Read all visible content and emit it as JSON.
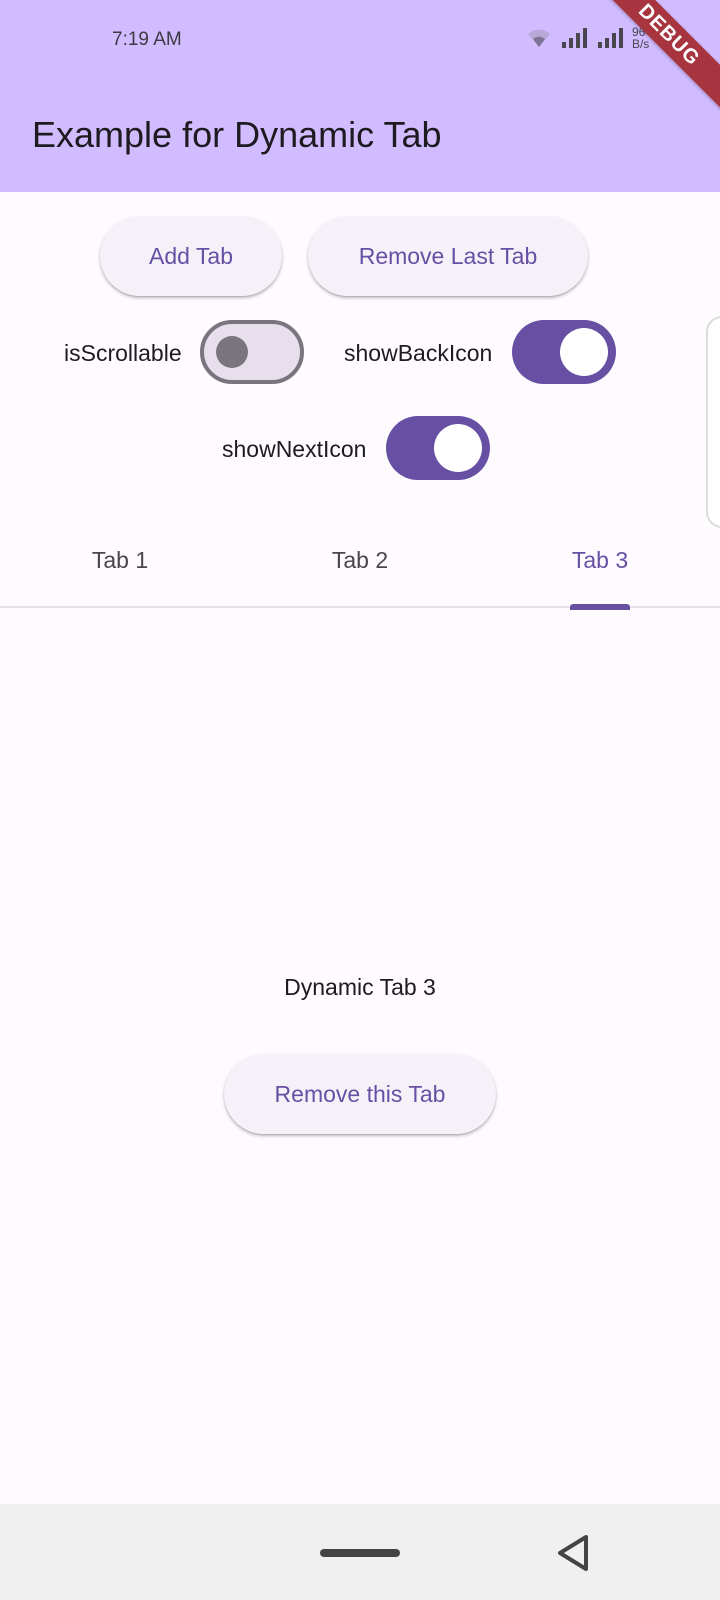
{
  "status_bar": {
    "time": "7:19 AM",
    "net_speed_value": "964",
    "net_speed_unit": "B/s"
  },
  "debug_banner": "DEBUG",
  "app_bar": {
    "title": "Example for Dynamic Tab"
  },
  "actions": {
    "add_tab": "Add Tab",
    "remove_last_tab": "Remove Last Tab"
  },
  "toggles": [
    {
      "label": "isScrollable",
      "on": false
    },
    {
      "label": "showBackIcon",
      "on": true
    },
    {
      "label": "showNextIcon",
      "on": true
    }
  ],
  "tabs": [
    {
      "label": "Tab 1",
      "selected": false
    },
    {
      "label": "Tab 2",
      "selected": false
    },
    {
      "label": "Tab 3",
      "selected": true
    }
  ],
  "content": {
    "text": "Dynamic Tab 3",
    "remove_button": "Remove this Tab"
  },
  "colors": {
    "primary": "#6750a4",
    "app_bar": "#d1bcff",
    "background": "#fefbff",
    "debug": "#a7343e"
  }
}
